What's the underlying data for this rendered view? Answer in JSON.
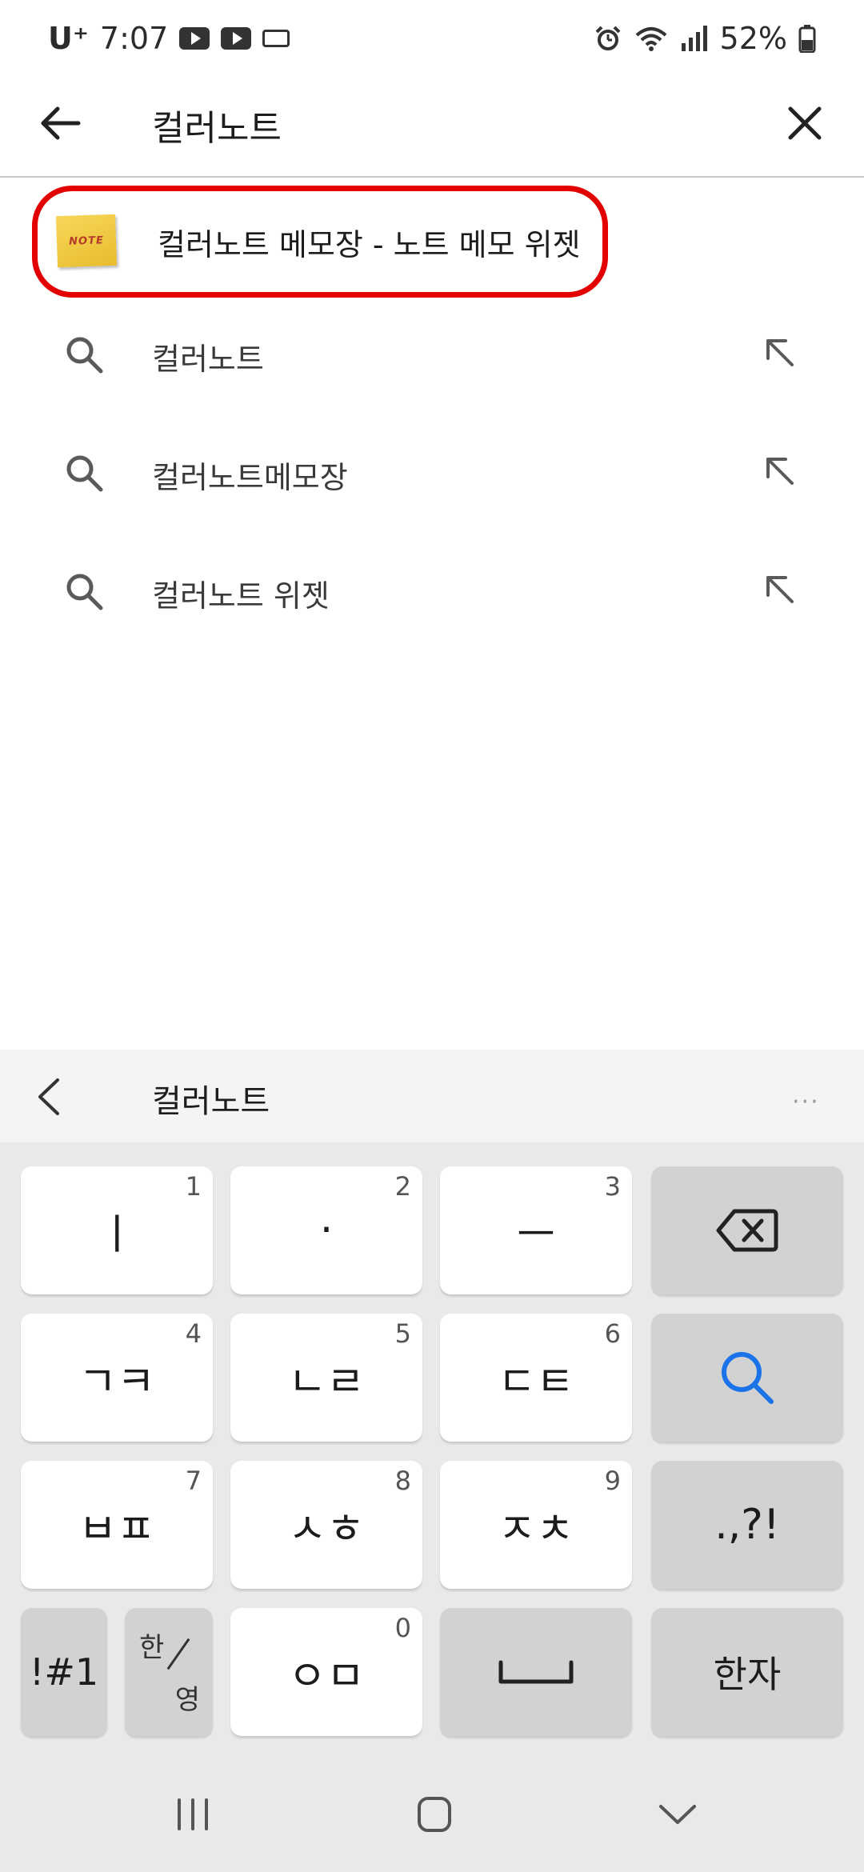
{
  "status_bar": {
    "carrier": "U⁺",
    "time": "7:07",
    "battery": "52%"
  },
  "search": {
    "query": "컬러노트",
    "back_icon": "arrow-left-icon",
    "clear_icon": "close-icon"
  },
  "app_result": {
    "icon_text": "NOTE",
    "label": "컬러노트 메모장 - 노트 메모 위젯",
    "highlight_color": "#e20000"
  },
  "suggestions": [
    {
      "text": "컬러노트"
    },
    {
      "text": "컬러노트메모장"
    },
    {
      "text": "컬러노트 위젯"
    }
  ],
  "keyboard": {
    "toolbar_text": "컬러노트",
    "more_label": "···",
    "rows": [
      [
        {
          "label": "ㅣ",
          "num": "1"
        },
        {
          "label": "·",
          "num": "2"
        },
        {
          "label": "ㅡ",
          "num": "3"
        }
      ],
      [
        {
          "label": "ㄱㅋ",
          "num": "4"
        },
        {
          "label": "ㄴㄹ",
          "num": "5"
        },
        {
          "label": "ㄷㅌ",
          "num": "6"
        }
      ],
      [
        {
          "label": "ㅂㅍ",
          "num": "7"
        },
        {
          "label": "ㅅㅎ",
          "num": "8"
        },
        {
          "label": "ㅈㅊ",
          "num": "9"
        }
      ]
    ],
    "punct_key": ".,?!",
    "symbols_key": "!#1",
    "lang_key_top": "한",
    "lang_key_bottom": "영",
    "bottom_key": {
      "label": "ㅇㅁ",
      "num": "0"
    },
    "space_key": "␣",
    "hanja_key": "한자",
    "accent_color": "#1a73e8"
  },
  "nav_bar": {
    "recents_icon": "recents-icon",
    "home_icon": "home-icon",
    "hide_keyboard_icon": "chevron-down-icon"
  }
}
